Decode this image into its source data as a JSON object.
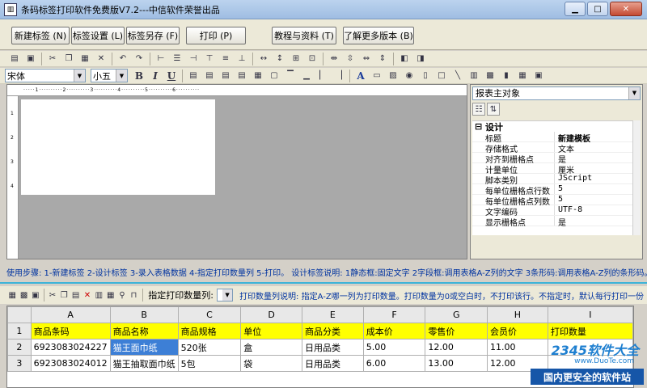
{
  "window": {
    "title": "条码标签打印软件免费版V7.2---中信软件荣誉出品",
    "app_icon": "barcode-icon",
    "controls": [
      "minimize",
      "maximize",
      "close"
    ]
  },
  "main_buttons": {
    "new_label": "新建标签 (N)",
    "label_settings": "标签设置 (L)",
    "save_as": "标签另存 (F)",
    "print": "打印 (P)",
    "tutorial": "教程与资料 (T)",
    "more_versions": "了解更多版本 (B)"
  },
  "format_bar": {
    "font_name": "宋体",
    "font_size": "小五",
    "bold": "B",
    "italic": "I",
    "underline": "U",
    "text_tool": "A"
  },
  "designer": {
    "ruler_marks": [
      "1",
      "2",
      "3",
      "4",
      "5",
      "6"
    ]
  },
  "properties": {
    "object_selector": "报表主对象",
    "section": "设计",
    "rows": [
      {
        "key": "标题",
        "value": "新建模板",
        "bold": true
      },
      {
        "key": "存储格式",
        "value": "文本"
      },
      {
        "key": "对齐到栅格点",
        "value": "是"
      },
      {
        "key": "计量单位",
        "value": "厘米"
      },
      {
        "key": "脚本类别",
        "value": "JScript"
      },
      {
        "key": "每单位栅格点行数",
        "value": "5"
      },
      {
        "key": "每单位栅格点列数",
        "value": "5"
      },
      {
        "key": "文字编码",
        "value": "UTF-8"
      },
      {
        "key": "显示栅格点",
        "value": "是"
      }
    ]
  },
  "steps_text": "使用步骤: 1-新建标签 2-设计标签 3-录入表格数据 4-指定打印数量列 5-打印。 设计标签说明: 1静态框:固定文字 2字段框:调用表格A-Z列的文字 3条形码:调用表格A-Z列的条形码。",
  "bottom_toolbar": {
    "print_qty_label": "指定打印数量列:",
    "print_qty_value": "",
    "explanation": "打印数量列说明: 指定A-Z哪一列为打印数量。打印数量为0或空白时，不打印该行。不指定时，默认每行打印一份"
  },
  "sheet": {
    "columns": [
      "A",
      "B",
      "C",
      "D",
      "E",
      "F",
      "G",
      "H",
      "I"
    ],
    "rows": [
      {
        "num": "1",
        "cells": [
          "商品条码",
          "商品名称",
          "商品规格",
          "单位",
          "商品分类",
          "成本价",
          "零售价",
          "会员价",
          "打印数量"
        ]
      },
      {
        "num": "2",
        "cells": [
          "6923083024227",
          "猫王面巾纸",
          "520张",
          "盒",
          "日用品类",
          "5.00",
          "12.00",
          "11.00",
          ""
        ]
      },
      {
        "num": "3",
        "cells": [
          "6923083024012",
          "猫王抽取面巾纸",
          "5包",
          "袋",
          "日用品类",
          "6.00",
          "13.00",
          "12.00",
          ""
        ]
      }
    ]
  },
  "watermark": {
    "logo": "2345软件大全",
    "site": "www.DuoTe.com",
    "banner": "国内更安全的软件站"
  }
}
